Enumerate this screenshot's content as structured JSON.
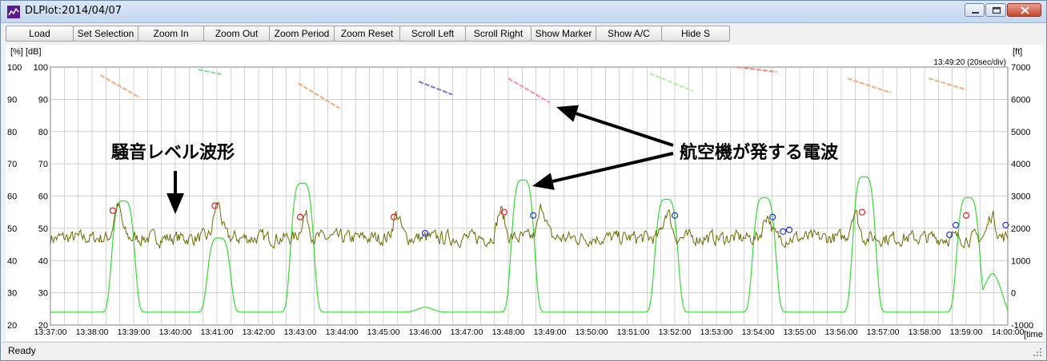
{
  "window": {
    "title": "DLPlot:2014/04/07"
  },
  "toolbar": {
    "buttons": [
      {
        "label": "Load"
      },
      {
        "label": "Set Selection"
      },
      {
        "label": "Zoom In"
      },
      {
        "label": "Zoom Out"
      },
      {
        "label": "Zoom Period"
      },
      {
        "label": "Zoom Reset"
      },
      {
        "label": "Scroll Left"
      },
      {
        "label": "Scroll Right"
      },
      {
        "label": "Show Marker"
      },
      {
        "label": "Show A/C"
      },
      {
        "label": "Hide S"
      }
    ]
  },
  "status": {
    "text": "Ready"
  },
  "colors": {
    "noise_line": "#6b6b00",
    "aircraft_count_line": "#33dd33",
    "grid": "#c0c0c0",
    "marker_red": "#dd2222",
    "marker_blue": "#2233cc",
    "annotation_arrow": "#000000"
  },
  "chart_data": {
    "type": "line",
    "left_axis_label": "[%] [dB]",
    "right_axis_label": "[ft]",
    "x_axis_label": "[time]",
    "timestamp_label": "13:49:20 (20sec/div)",
    "y_left_ticks": [
      "100",
      "90",
      "80",
      "70",
      "60",
      "50",
      "40",
      "30",
      "20"
    ],
    "y_left_ticks_inner": [
      "100",
      "90",
      "80",
      "70",
      "60",
      "50",
      "40",
      "30",
      "20"
    ],
    "y_right_ticks": [
      "7000",
      "6000",
      "5000",
      "4000",
      "3000",
      "2000",
      "1000",
      "0",
      "-1000"
    ],
    "y_left_range": [
      20,
      100
    ],
    "y_right_range": [
      -1000,
      7000
    ],
    "x_ticks": [
      "13:37:00",
      "13:38:00",
      "13:39:00",
      "13:40:00",
      "13:41:00",
      "13:42:00",
      "13:43:00",
      "13:44:00",
      "13:45:00",
      "13:46:00",
      "13:47:00",
      "13:48:00",
      "13:49:00",
      "13:50:00",
      "13:51:00",
      "13:52:00",
      "13:53:00",
      "13:54:00",
      "13:55:00",
      "13:56:00",
      "13:57:00",
      "13:58:00",
      "13:59:00",
      "14:00:00"
    ],
    "x_range_minutes": [
      0,
      23
    ],
    "grid": true,
    "noise_baseline_db": 47,
    "noise_peaks": [
      {
        "t": 1.6,
        "db": 55
      },
      {
        "t": 4.0,
        "db": 56
      },
      {
        "t": 6.1,
        "db": 53
      },
      {
        "t": 8.3,
        "db": 53
      },
      {
        "t": 10.8,
        "db": 54
      },
      {
        "t": 11.8,
        "db": 55
      },
      {
        "t": 14.8,
        "db": 54
      },
      {
        "t": 17.2,
        "db": 53
      },
      {
        "t": 19.3,
        "db": 54
      },
      {
        "t": 22.6,
        "db": 53
      }
    ],
    "aircraft_peaks": [
      {
        "t": 1.75,
        "db": 58.5
      },
      {
        "t": 4.05,
        "db": 47
      },
      {
        "t": 6.05,
        "db": 64
      },
      {
        "t": 11.35,
        "db": 65
      },
      {
        "t": 14.8,
        "db": 59
      },
      {
        "t": 17.15,
        "db": 59.5
      },
      {
        "t": 19.55,
        "db": 66
      },
      {
        "t": 22.05,
        "db": 59.5
      }
    ],
    "aircraft_baseline_db": 24,
    "small_bump": {
      "t": 9.0,
      "db": 25.5
    },
    "tail_bump": {
      "t": 22.65,
      "db": 36
    },
    "red_markers": [
      {
        "t": 1.5,
        "db": 55.5
      },
      {
        "t": 3.95,
        "db": 57
      },
      {
        "t": 6.0,
        "db": 53.5
      },
      {
        "t": 8.25,
        "db": 53.5
      },
      {
        "t": 10.9,
        "db": 55
      },
      {
        "t": 19.5,
        "db": 55
      },
      {
        "t": 22.0,
        "db": 54
      }
    ],
    "blue_markers": [
      {
        "t": 9.0,
        "db": 48.5
      },
      {
        "t": 11.6,
        "db": 54
      },
      {
        "t": 15.0,
        "db": 54
      },
      {
        "t": 17.35,
        "db": 53.5
      },
      {
        "t": 17.6,
        "db": 49
      },
      {
        "t": 17.75,
        "db": 49.5
      },
      {
        "t": 21.6,
        "db": 48
      },
      {
        "t": 21.75,
        "db": 51
      },
      {
        "t": 22.95,
        "db": 51
      }
    ],
    "altitude_tracks": [
      {
        "t0": 1.2,
        "t1": 2.15,
        "ft0": 6750,
        "ft1": 6050,
        "color": "#f4b183"
      },
      {
        "t0": 3.55,
        "t1": 4.1,
        "ft0": 6920,
        "ft1": 6780,
        "color": "#7fe0a0"
      },
      {
        "t0": 5.95,
        "t1": 6.95,
        "ft0": 6500,
        "ft1": 5720,
        "color": "#f4b183"
      },
      {
        "t0": 8.85,
        "t1": 9.65,
        "ft0": 6550,
        "ft1": 6150,
        "color": "#7f7fe0"
      },
      {
        "t0": 11.0,
        "t1": 12.0,
        "ft0": 6650,
        "ft1": 5900,
        "color": "#f08fc0"
      },
      {
        "t0": 14.4,
        "t1": 15.45,
        "ft0": 6800,
        "ft1": 6250,
        "color": "#b5f0a0"
      },
      {
        "t0": 16.5,
        "t1": 17.45,
        "ft0": 7000,
        "ft1": 6850,
        "color": "#f08f8f"
      },
      {
        "t0": 19.15,
        "t1": 20.2,
        "ft0": 6650,
        "ft1": 6200,
        "color": "#f4b183"
      },
      {
        "t0": 21.1,
        "t1": 22.0,
        "ft0": 6650,
        "ft1": 6300,
        "color": "#f4b183"
      }
    ],
    "annotations": [
      {
        "text": "騒音レベル波形"
      },
      {
        "text": "航空機が発する電波"
      }
    ]
  }
}
